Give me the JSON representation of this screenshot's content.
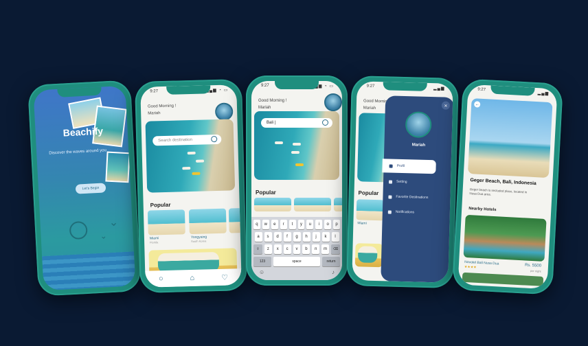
{
  "status_time": "9:27",
  "splash": {
    "title": "Beachify",
    "tagline": "Discover the waves around you",
    "cta": "Let's Begin"
  },
  "home": {
    "greeting": "Good Morning !",
    "user": "Mariah",
    "search_placeholder": "Search destination",
    "popular_label": "Popular",
    "cards": [
      {
        "name": "Miami",
        "sub": "Florida"
      },
      {
        "name": "Yongyaing",
        "sub": "South Korea"
      }
    ],
    "tabs": [
      "search-icon",
      "home-icon",
      "heart-icon"
    ]
  },
  "search_screen": {
    "greeting": "Good Morning !",
    "user": "Mariah",
    "query": "Bali |",
    "popular_label": "Popular",
    "keyboard_rows": [
      [
        "q",
        "w",
        "e",
        "r",
        "t",
        "y",
        "u",
        "i",
        "o",
        "p"
      ],
      [
        "a",
        "s",
        "d",
        "f",
        "g",
        "h",
        "j",
        "k",
        "l"
      ],
      [
        "z",
        "x",
        "c",
        "v",
        "b",
        "n",
        "m"
      ]
    ],
    "key_123": "123",
    "key_space": "space",
    "key_return": "return"
  },
  "drawer": {
    "greeting": "Good Morning !",
    "user": "Mariah",
    "popular_label": "Popular",
    "card_label": "Miami",
    "profile_name": "Mariah",
    "items": [
      "Profil",
      "Setting",
      "Favorite Destinations",
      "Notifications"
    ]
  },
  "detail": {
    "title": "Geger Beach, Bali, Indonesia",
    "description": "Geger beach is secluded place, located in Nusa Dua area.",
    "nearby_label": "Nearby Hotels",
    "hotel_name": "Novotel Bali Nusa Dua",
    "rating": "★★★★",
    "price": "Rs. 5500",
    "price_unit": "per night"
  },
  "colors": {
    "background": "#0a1a33",
    "phone": "#1f8e7e",
    "accent": "#2a6d8a",
    "drawer": "#2d4b7c"
  }
}
